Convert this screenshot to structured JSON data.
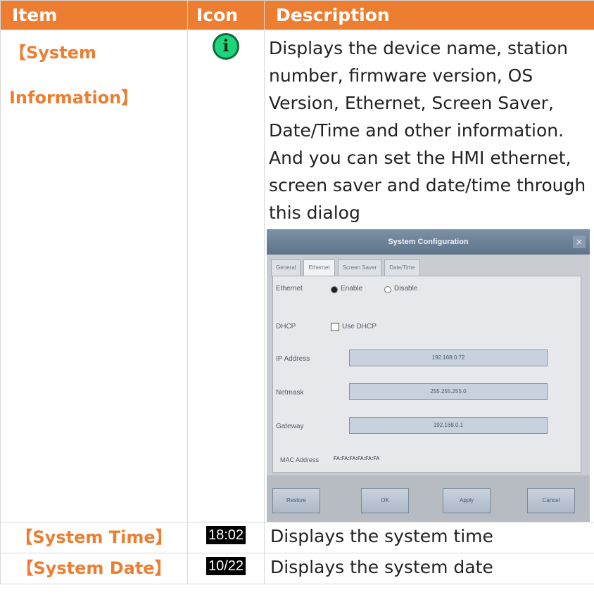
{
  "header": {
    "item": "Item",
    "icon": "Icon",
    "description": "Description"
  },
  "rows": [
    {
      "item_line1": "【System",
      "item_line2": "Information】",
      "icon_glyph": "i",
      "icon_name": "info-icon",
      "description": "Displays the device name, station number, firmware version, OS Version, Ethernet, Screen Saver, Date/Time and other information. And you can set the HMI ethernet, screen saver and date/time through this dialog"
    },
    {
      "item": "【System Time】",
      "icon_text": "18:02",
      "description": "Displays the system time"
    },
    {
      "item": "【System Date】",
      "icon_text": "10/22",
      "description": "Displays the system date"
    }
  ],
  "dialog": {
    "title": "System Configuration",
    "close": "×",
    "tabs": [
      "General",
      "Ethernet",
      "Screen Saver",
      "Date/Time"
    ],
    "ethernet_label": "Ethernet",
    "enable": "Enable",
    "disable": "Disable",
    "dhcp_label": "DHCP",
    "use_dhcp": "Use DHCP",
    "ip_label": "IP Address",
    "ip_value": "192.168.0.72",
    "netmask_label": "Netmask",
    "netmask_value": "255.255.255.0",
    "gateway_label": "Gateway",
    "gateway_value": "192.168.0.1",
    "mac_label": "MAC Address",
    "mac_value": "FA:FA:FA:FA:FA:FA",
    "buttons": [
      "Restore",
      "OK",
      "Apply",
      "Cancel"
    ]
  }
}
